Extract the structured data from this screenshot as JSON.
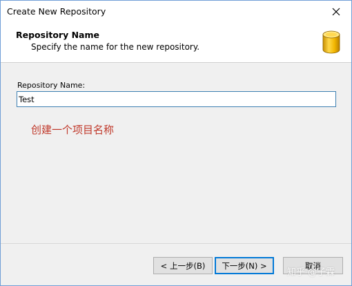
{
  "window": {
    "title": "Create New Repository"
  },
  "header": {
    "title": "Repository Name",
    "subtitle": "Specify the name for the new repository.",
    "icon": "database-icon"
  },
  "form": {
    "label": "Repository Name:",
    "value": "Test"
  },
  "annotation": "创建一个项目名称",
  "buttons": {
    "back": "< 上一步(B)",
    "next": "下一步(N) >",
    "cancel": "取消"
  },
  "watermark": "知乎 @子霖",
  "colors": {
    "accent": "#0078d7",
    "annotation": "#c0392b",
    "icon_yellow": "#f5c518"
  }
}
